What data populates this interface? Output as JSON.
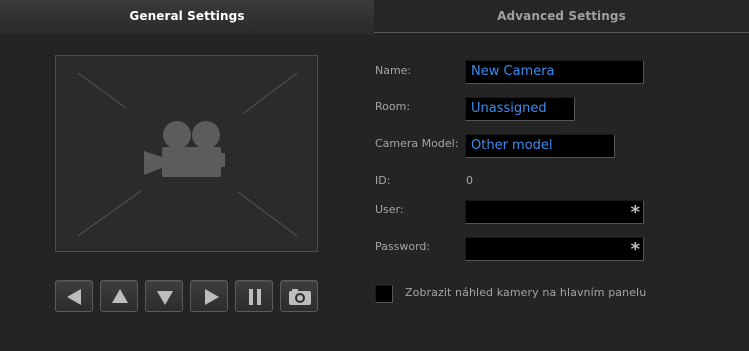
{
  "tabs": {
    "general": "General Settings",
    "advanced": "Advanced Settings"
  },
  "preview": {
    "icon": "video-camera-icon"
  },
  "controls": [
    {
      "name": "pan-left",
      "icon": "arrow-left-icon"
    },
    {
      "name": "tilt-up",
      "icon": "arrow-up-icon"
    },
    {
      "name": "tilt-down",
      "icon": "arrow-down-icon"
    },
    {
      "name": "pan-right",
      "icon": "arrow-right-icon"
    },
    {
      "name": "pause",
      "icon": "pause-icon"
    },
    {
      "name": "snapshot",
      "icon": "camera-icon"
    }
  ],
  "form": {
    "name_label": "Name:",
    "name_value": "New Camera",
    "room_label": "Room:",
    "room_value": "Unassigned",
    "model_label": "Camera Model:",
    "model_value": "Other model",
    "id_label": "ID:",
    "id_value": "0",
    "user_label": "User:",
    "user_value": "",
    "password_label": "Password:",
    "password_value": "",
    "required_mark": "*",
    "show_preview_label": "Zobrazit náhled kamery na hlavním panelu",
    "show_preview_checked": false
  },
  "colors": {
    "accent": "#3d8cf0",
    "background": "#242424",
    "field_bg": "#000000"
  }
}
